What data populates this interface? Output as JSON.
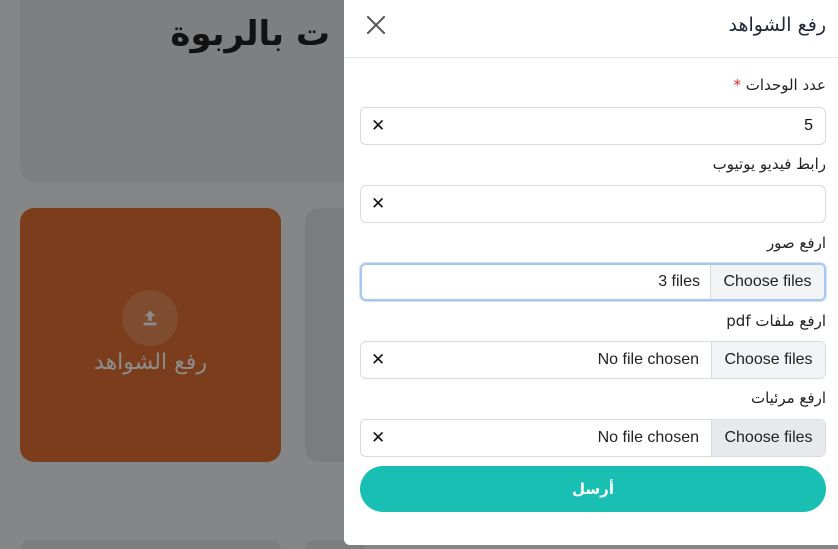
{
  "background": {
    "hero_title": "ت بالربوة",
    "card_label": "رفع الشواهد",
    "card_icon": "upload-icon"
  },
  "drawer": {
    "title": "رفع الشواهد",
    "close_icon": "close-icon",
    "fields": {
      "units": {
        "label": "عدد الوحدات",
        "required_mark": "*",
        "value": "5"
      },
      "youtube": {
        "label": "رابط فيديو يوتيوب",
        "value": ""
      },
      "images": {
        "label": "ارفع صور",
        "button": "Choose files",
        "status": "3 files"
      },
      "pdf": {
        "label": "ارفع ملفات pdf",
        "button": "Choose files",
        "status": "No file chosen"
      },
      "videos": {
        "label": "ارفع مرئيات",
        "button": "Choose files",
        "status": "No file chosen"
      }
    },
    "clear_glyph": "✕",
    "submit_label": "أرسل"
  },
  "colors": {
    "accent": "#1abfb3",
    "card": "#e07032",
    "required": "#dc2626"
  }
}
